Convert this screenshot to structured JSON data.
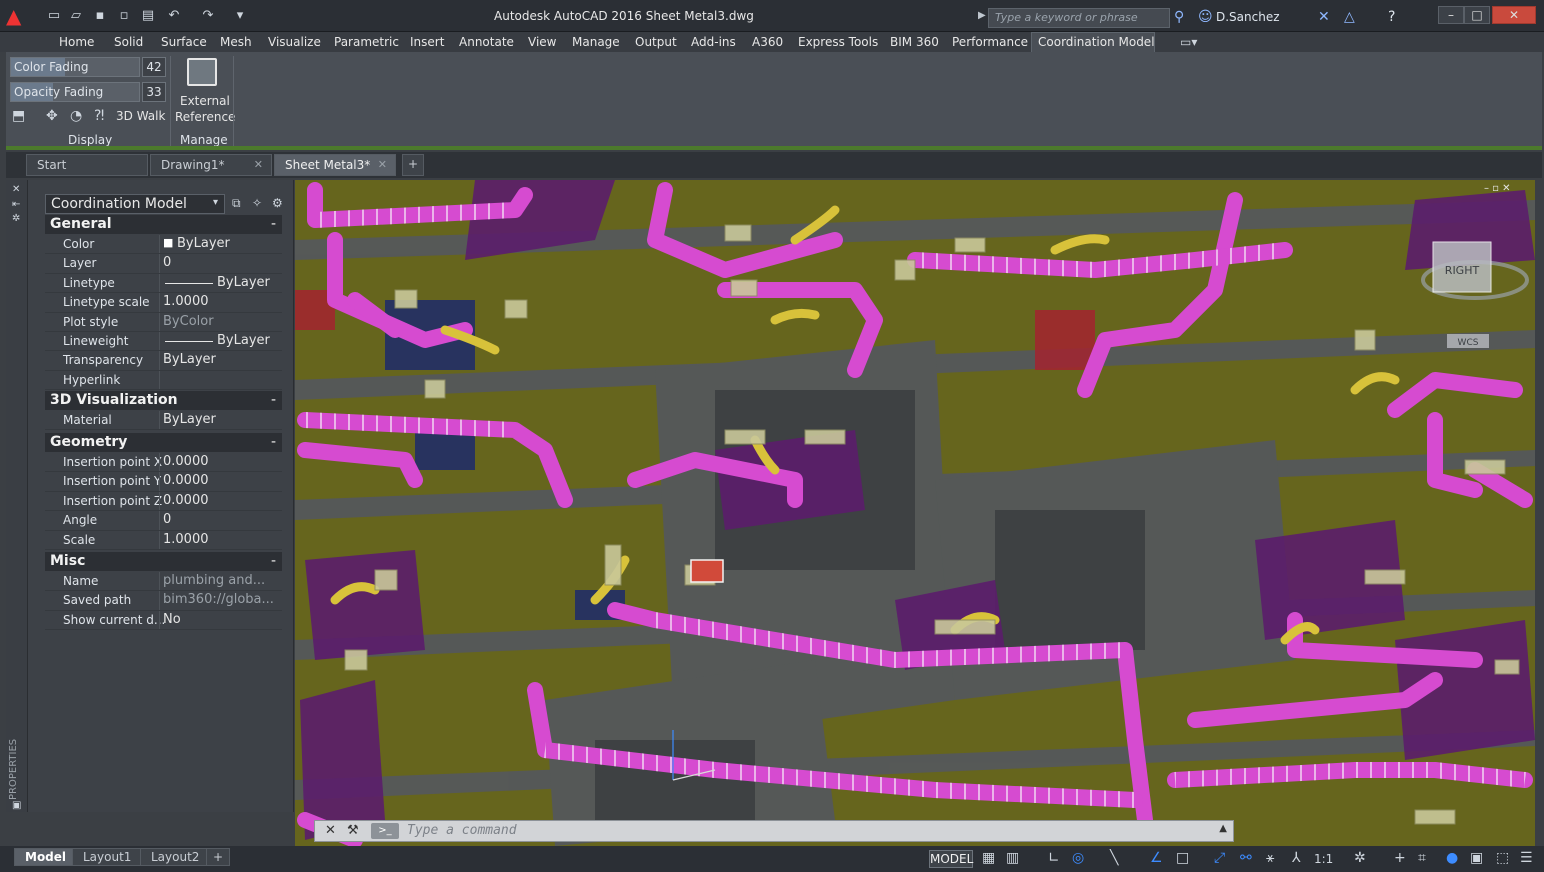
{
  "title_bar": {
    "title": "Autodesk AutoCAD 2016   Sheet Metal3.dwg",
    "search_placeholder": "Type a keyword or phrase",
    "user": "D.Sanchez"
  },
  "ribbon_tabs": [
    "Home",
    "Solid",
    "Surface",
    "Mesh",
    "Visualize",
    "Parametric",
    "Insert",
    "Annotate",
    "View",
    "Manage",
    "Output",
    "Add-ins",
    "A360",
    "Express Tools",
    "BIM 360",
    "Performance",
    "Coordination Model"
  ],
  "ribbon": {
    "color_fading": {
      "label": "Color Fading",
      "value": "42",
      "fraction": 0.42
    },
    "opacity_fading": {
      "label": "Opacity Fading",
      "value": "33",
      "fraction": 0.33
    },
    "walk_label": "3D Walk",
    "external_ref_label_1": "External",
    "external_ref_label_2": "Reference",
    "panel_display": "Display",
    "panel_manage": "Manage"
  },
  "doc_tabs": [
    "Start",
    "Drawing1*",
    "Sheet Metal3*"
  ],
  "properties": {
    "selector": "Coordination Model",
    "sections": {
      "general": "General",
      "visualization": "3D Visualization",
      "geometry": "Geometry",
      "misc": "Misc"
    },
    "general_rows": [
      {
        "name": "Color",
        "value": "ByLayer"
      },
      {
        "name": "Layer",
        "value": "0"
      },
      {
        "name": "Linetype",
        "value": "ByLayer"
      },
      {
        "name": "Linetype scale",
        "value": "1.0000"
      },
      {
        "name": "Plot style",
        "value": "ByColor"
      },
      {
        "name": "Lineweight",
        "value": "ByLayer"
      },
      {
        "name": "Transparency",
        "value": "ByLayer"
      },
      {
        "name": "Hyperlink",
        "value": ""
      }
    ],
    "visualization_rows": [
      {
        "name": "Material",
        "value": "ByLayer"
      }
    ],
    "geometry_rows": [
      {
        "name": "Insertion point X",
        "value": "0.0000"
      },
      {
        "name": "Insertion point Y",
        "value": "0.0000"
      },
      {
        "name": "Insertion point Z",
        "value": "0.0000"
      },
      {
        "name": "Angle",
        "value": "0"
      },
      {
        "name": "Scale",
        "value": "1.0000"
      }
    ],
    "misc_rows": [
      {
        "name": "Name",
        "value": "plumbing and..."
      },
      {
        "name": "Saved path",
        "value": "bim360://globa..."
      },
      {
        "name": "Show current d...",
        "value": "No"
      }
    ],
    "palette_label": "PROPERTIES"
  },
  "viewcube": {
    "face": "RIGHT",
    "wcs": "WCS"
  },
  "command_line": {
    "placeholder": "Type a command"
  },
  "layout_tabs": [
    "Model",
    "Layout1",
    "Layout2"
  ],
  "status": {
    "model": "MODEL",
    "scale": "1:1"
  },
  "colors": {
    "duct": "#d64bd0",
    "floor": "#6b6a1e",
    "accent_blue": "#3d8cff"
  }
}
